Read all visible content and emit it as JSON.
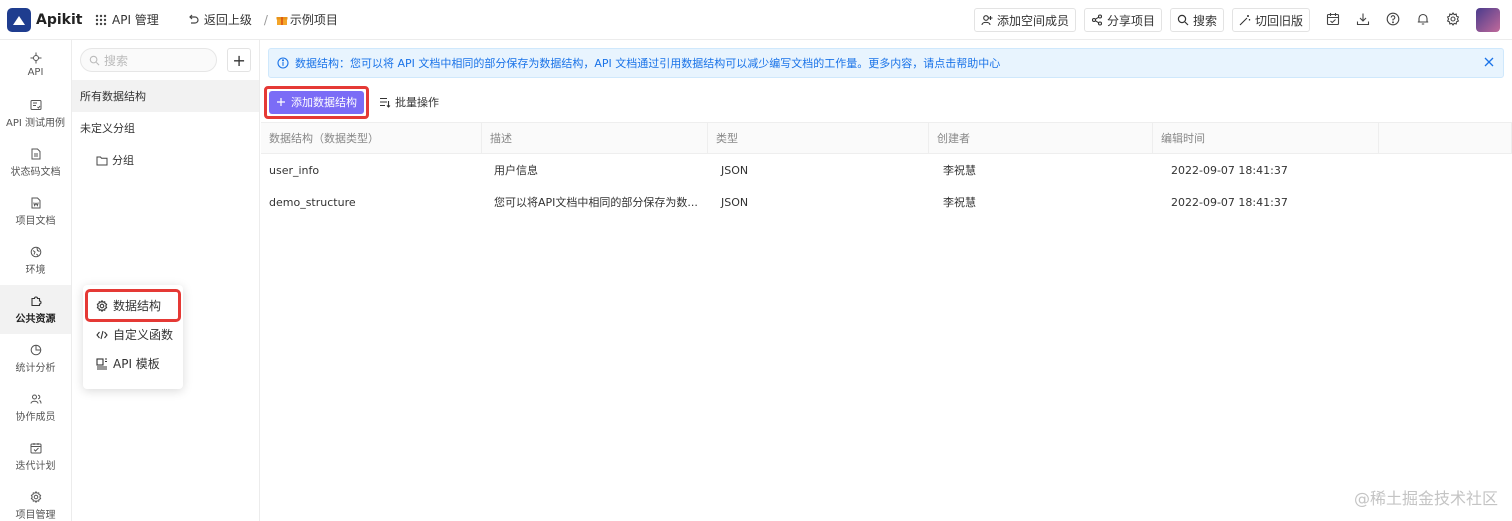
{
  "app": {
    "name": "Apikit"
  },
  "header": {
    "api_manage": "API 管理",
    "back": "返回上级",
    "separator": "/",
    "project": "示例项目",
    "buttons": {
      "add_member": "添加空间成员",
      "share": "分享项目",
      "search": "搜索",
      "switch_old": "切回旧版"
    }
  },
  "rail": [
    {
      "label": "API",
      "icon": "api-icon"
    },
    {
      "label": "API 测试用例",
      "icon": "test-case-icon"
    },
    {
      "label": "状态码文档",
      "icon": "doc-icon"
    },
    {
      "label": "项目文档",
      "icon": "word-doc-icon"
    },
    {
      "label": "环境",
      "icon": "environment-icon"
    },
    {
      "label": "公共资源",
      "icon": "puzzle-icon",
      "active": true
    },
    {
      "label": "统计分析",
      "icon": "pie-chart-icon"
    },
    {
      "label": "协作成员",
      "icon": "users-icon"
    },
    {
      "label": "迭代计划",
      "icon": "calendar-icon"
    },
    {
      "label": "项目管理",
      "icon": "gear-icon"
    }
  ],
  "popup": [
    {
      "label": "数据结构",
      "icon": "gear-icon",
      "active": true
    },
    {
      "label": "自定义函数",
      "icon": "code-icon"
    },
    {
      "label": "API 模板",
      "icon": "template-icon"
    }
  ],
  "sidebar2": {
    "search_placeholder": "搜索",
    "add": "+",
    "all": "所有数据结构",
    "ungrouped": "未定义分组",
    "group": "分组"
  },
  "banner": {
    "text": "数据结构：您可以将 API 文档中相同的部分保存为数据结构，API 文档通过引用数据结构可以减少编写文档的工作量。更多内容，请点击帮助中心"
  },
  "toolbar": {
    "add": "添加数据结构",
    "batch": "批量操作"
  },
  "table": {
    "columns": [
      "数据结构（数据类型）",
      "描述",
      "类型",
      "创建者",
      "编辑时间",
      ""
    ],
    "rows": [
      [
        "user_info",
        "用户信息",
        "JSON",
        "李祝慧",
        "2022-09-07 18:41:37"
      ],
      [
        "demo_structure",
        "您可以将API文档中相同的部分保存为数...",
        "JSON",
        "李祝慧",
        "2022-09-07 18:41:37"
      ]
    ]
  },
  "watermark": "@稀土掘金技术社区",
  "colors": {
    "primary": "#7b6cf6",
    "highlight": "#e53935",
    "banner_bg": "#e8f4fe",
    "banner_text": "#1a73e8"
  }
}
